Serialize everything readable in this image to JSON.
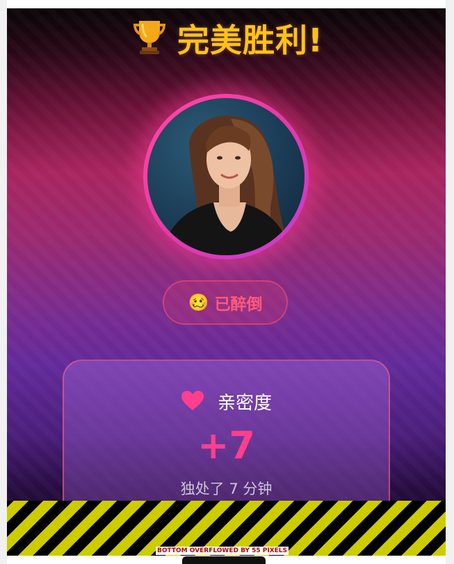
{
  "header": {
    "trophy_icon": "trophy-icon",
    "title": "完美胜利!"
  },
  "profile": {
    "avatar": "portrait-photo"
  },
  "status": {
    "emoji": "🥴",
    "label": "已醉倒"
  },
  "intimacy_card": {
    "heart_icon": "heart-icon",
    "label": "亲密度",
    "score": "+7",
    "duration": "独处了 7 分钟"
  },
  "debug": {
    "overflow_message": "BOTTOM OVERFLOWED BY 55 PIXELS"
  },
  "colors": {
    "title": "#ffc21a",
    "accent_pink": "#ff3f8e",
    "status_text": "#ff5a7a",
    "overflow_stripe": "#cccc00"
  }
}
